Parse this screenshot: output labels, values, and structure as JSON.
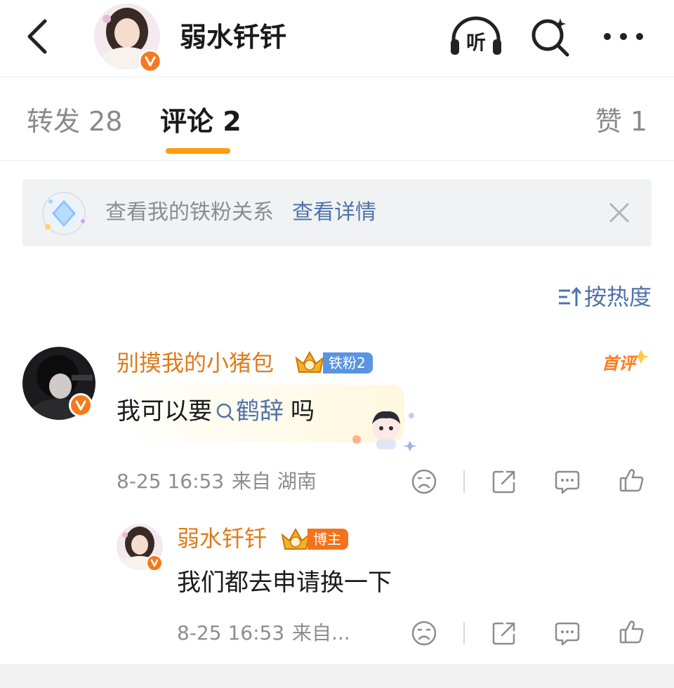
{
  "header": {
    "username": "弱水钎钎",
    "listen_label": "听"
  },
  "tabs": [
    {
      "label": "转发 28",
      "active": false
    },
    {
      "label": "评论 2",
      "active": true
    },
    {
      "label": "赞 1",
      "active": false
    }
  ],
  "banner": {
    "text": "查看我的铁粉关系",
    "link": "查看详情"
  },
  "sort": {
    "label": "按热度"
  },
  "comment": {
    "username": "别摸我的小猪包",
    "fan_badge": "铁粉2",
    "first_tag": "首评",
    "text_before": "我可以要",
    "link_text": "鹤辞",
    "text_after": "吗",
    "time": "8-25 16:53",
    "source": "来自 湖南"
  },
  "reply": {
    "username": "弱水钎钎",
    "badge": "博主",
    "text": "我们都去申请换一下",
    "time": "8-25 16:53",
    "source": "来自..."
  },
  "colors": {
    "accent_orange": "#ff9b0f",
    "name_orange": "#e07b1b",
    "link_blue": "#4f73a8",
    "fan_badge_blue": "#5a94e0",
    "host_badge_orange": "#f3721c"
  }
}
